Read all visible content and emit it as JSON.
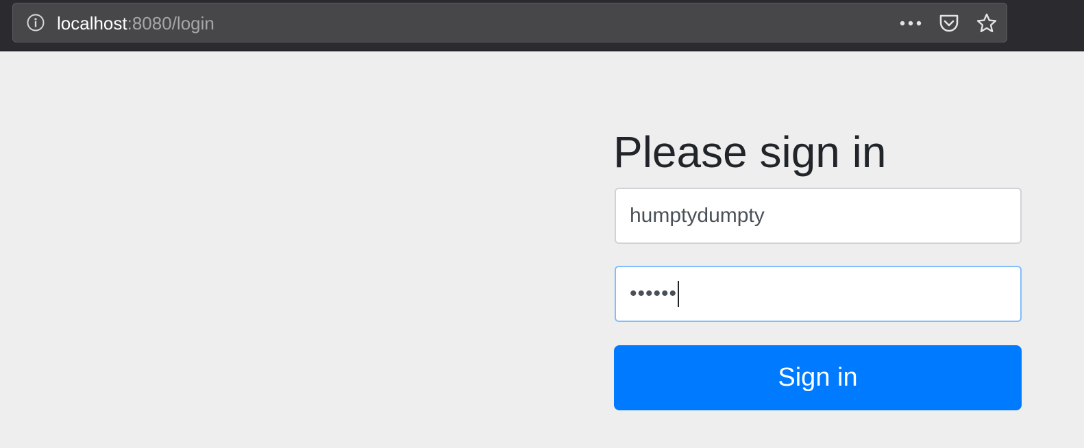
{
  "browser": {
    "url_host": "localhost",
    "url_rest": ":8080/login",
    "icons": {
      "info": "info-icon",
      "more": "more-icon",
      "pocket": "pocket-icon",
      "bookmark": "star-icon"
    }
  },
  "login": {
    "heading": "Please sign in",
    "username_value": "humptydumpty",
    "password_display": "••••••",
    "submit_label": "Sign in"
  },
  "colors": {
    "accent": "#007bff",
    "focus_border": "#80bdff",
    "page_background": "#eeeeee",
    "toolbar_background": "#2b2a2e"
  }
}
